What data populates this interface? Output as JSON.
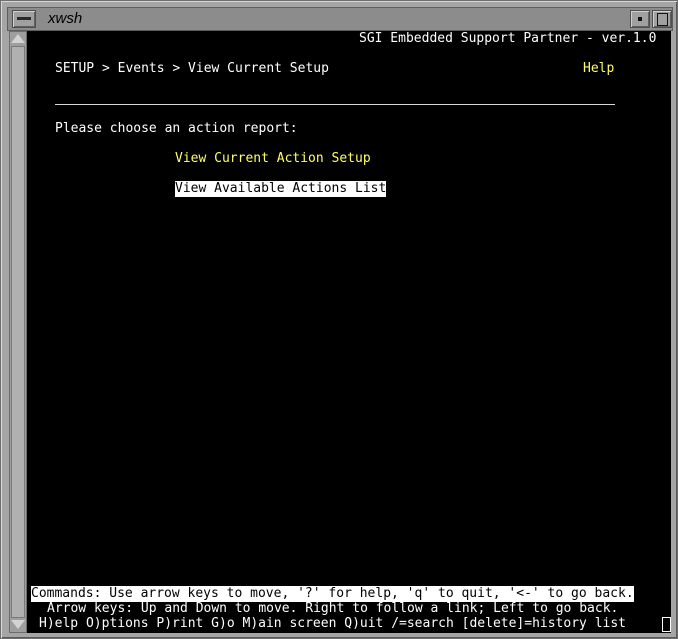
{
  "window": {
    "title": "xwsh"
  },
  "header": {
    "version_text": "SGI Embedded Support Partner - ver.1.0",
    "breadcrumb": "SETUP > Events > View Current Setup",
    "help_link": "Help"
  },
  "main": {
    "prompt": "Please choose an action report:",
    "links": [
      {
        "label": "View Current Action Setup",
        "selected": false
      },
      {
        "label": "View Available Actions List",
        "selected": true
      }
    ]
  },
  "footer": {
    "commands": "Commands: Use arrow keys to move, '?' for help, 'q' to quit, '<-' to go back.",
    "arrow_keys": "Arrow keys: Up and Down to move. Right to follow a link; Left to go back.",
    "shortcuts": "H)elp O)ptions P)rint G)o M)ain screen Q)uit /=search [delete]=history list"
  },
  "colors": {
    "terminal_bg": "#000000",
    "text": "#ffffff",
    "link": "#ffff66",
    "frame": "#a5a5a5"
  }
}
